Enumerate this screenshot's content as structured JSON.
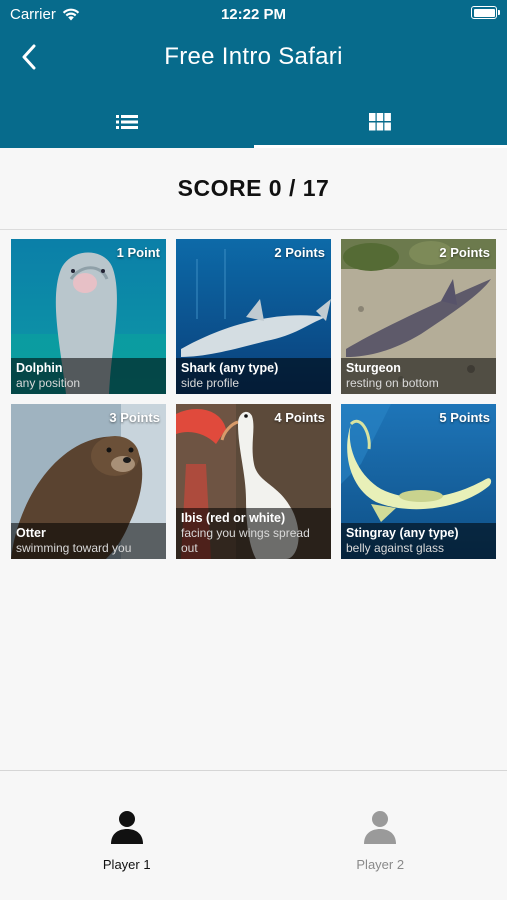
{
  "status_bar": {
    "carrier": "Carrier",
    "time": "12:22 PM"
  },
  "nav": {
    "title": "Free Intro Safari"
  },
  "tabs": [
    {
      "icon": "list-icon",
      "active": false
    },
    {
      "icon": "grid-icon",
      "active": true
    }
  ],
  "score": {
    "text": "SCORE 0 / 17"
  },
  "cards": [
    {
      "name": "Dolphin",
      "desc": "any position",
      "points": "1 Point"
    },
    {
      "name": "Shark (any type)",
      "desc": "side profile",
      "points": "2 Points"
    },
    {
      "name": "Sturgeon",
      "desc": "resting on bottom",
      "points": "2 Points"
    },
    {
      "name": "Otter",
      "desc": "swimming toward you",
      "points": "3 Points"
    },
    {
      "name": "Ibis (red or white)",
      "desc": "facing you wings spread out",
      "points": "4 Points"
    },
    {
      "name": "Stingray (any type)",
      "desc": "belly against glass",
      "points": "5 Points"
    }
  ],
  "players": [
    {
      "label": "Player 1",
      "active": true
    },
    {
      "label": "Player 2",
      "active": false
    }
  ],
  "colors": {
    "header": "#076b8c",
    "active_player": "#111111",
    "inactive_player": "#9a9a9a"
  }
}
